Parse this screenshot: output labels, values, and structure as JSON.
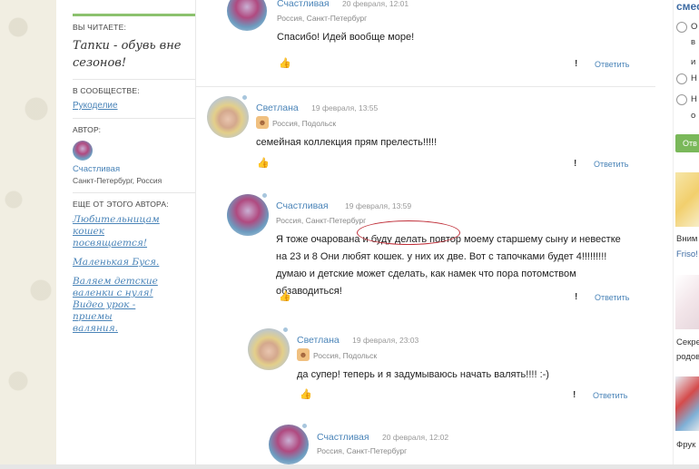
{
  "sidebar": {
    "reading_head": "ВЫ ЧИТАЕТЕ:",
    "reading_title": "Тапки - обувь вне сезонов!",
    "community_head": "В СООБЩЕСТВЕ:",
    "community_link": "Рукоделие",
    "author_head": "АВТОР:",
    "author_name": "Счастливая",
    "author_city": "Санкт-Петербург, Россия",
    "more_head": "ЕЩЕ ОТ ЭТОГО АВТОРА:",
    "more_links": [
      "Любительницам кошек посвящается!",
      "Маленькая Буся.",
      "Валяем детские валенки с нуля! Видео урок - приемы валяния."
    ]
  },
  "comments": [
    {
      "name": "Счастливая",
      "date": "20 февраля, 12:01",
      "city": "Россия, Санкт-Петербург",
      "text": "Спасибо! Идей вообще море!",
      "reply": "Ответить"
    },
    {
      "name": "Светлана",
      "date": "19 февраля, 13:55",
      "city": "Россия, Подольск",
      "text": "семейная коллекция прям прелесть!!!!!",
      "reply": "Ответить"
    },
    {
      "name": "Счастливая",
      "date": "19 февраля, 13:59",
      "city": "Россия, Санкт-Петербург",
      "text": "Я тоже очарована и буду делать повтор моему старшему сыну и невестке на 23 и 8 Они любят кошек. у них их две. Вот с тапочками будет 4!!!!!!!!! думаю и детские может сделать, как намек что пора потомством обзаводиться!",
      "reply": "Ответить"
    },
    {
      "name": "Светлана",
      "date": "19 февраля, 23:03",
      "city": "Россия, Подольск",
      "text": "да супер! теперь и я задумываюсь начать валять!!!! :-)",
      "reply": "Ответить"
    },
    {
      "name": "Счастливая",
      "date": "20 февраля, 12:02",
      "city": "Россия, Санкт-Петербург",
      "text": "",
      "reply": ""
    }
  ],
  "right": {
    "title": "смес",
    "options": [
      "О",
      "Н",
      "Н"
    ],
    "option_extras": [
      "в",
      "и",
      "о"
    ],
    "vote_button": "Отв",
    "items": [
      "Вним",
      "Friso!",
      "Секре",
      "родов",
      "Фрук"
    ]
  },
  "colors": {
    "accent_green": "#8cc26e",
    "link_blue": "#4a84b8",
    "highlight_red": "#c0303a"
  },
  "icons": [
    "thumb-up-icon",
    "exclamation-icon",
    "online-dot-icon",
    "level-badge-icon"
  ]
}
